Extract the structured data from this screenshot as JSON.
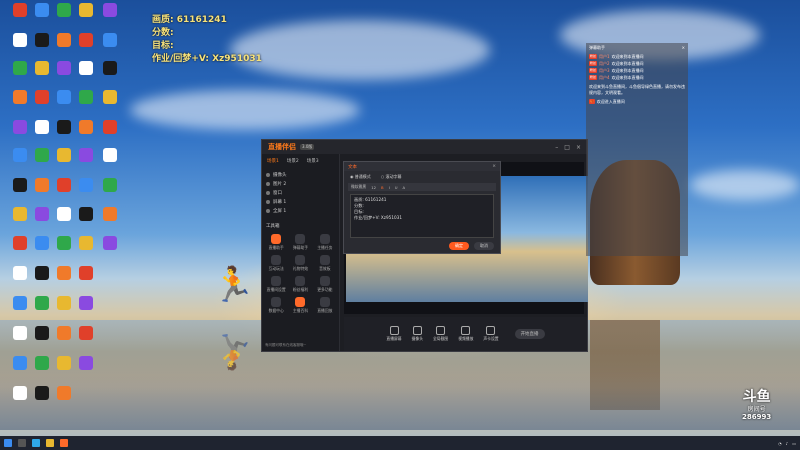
{
  "overlay": {
    "line1": "画质: 61161241",
    "line2": "分数:",
    "line3": "目标:",
    "line4": "作业/回梦+V: Xz951031"
  },
  "app": {
    "logo": "直播伴侣",
    "badge": "3.0版",
    "tabs": [
      "场景1",
      "场景2",
      "场景3"
    ],
    "sources": [
      "摄像头",
      "图片 2",
      "窗口",
      "屏幕 1",
      "全屏 1"
    ],
    "tools_heading": "工具箱",
    "tools": [
      "直播助手",
      "弹幕助手",
      "主播任务",
      "互动玩法",
      "礼物特效",
      "音效板",
      "直播间设置",
      "粉丝福利",
      "更多功能",
      "数据中心",
      "主播百科",
      "直播回放"
    ],
    "footnote": "有问题可联系在线客服哦~",
    "bottom_bar": [
      "直播屏幕",
      "摄像头",
      "全局截图",
      "视频播放",
      "声卡设置"
    ],
    "live_button": "开始直播"
  },
  "dialog": {
    "title": "文本",
    "radio1": "普通模式",
    "radio2": "滚动字幕",
    "font_select": "微软雅黑",
    "size": "12",
    "text_lines": [
      "画质: 61161241",
      "分数:",
      "目标:",
      "作业/回梦+V: Xz951031"
    ],
    "ok": "确定",
    "cancel": "取消"
  },
  "chat": {
    "title": "弹幕助手",
    "messages": [
      {
        "badge": "粉丝",
        "user": "用户1",
        "text": "欢迎来到本直播间"
      },
      {
        "badge": "粉丝",
        "user": "用户2",
        "text": "欢迎来到本直播间"
      },
      {
        "badge": "粉丝",
        "user": "用户3",
        "text": "欢迎来到本直播间"
      },
      {
        "badge": "粉丝",
        "user": "用户4",
        "text": "欢迎来到本直播间"
      }
    ],
    "notice": "欢迎来到斗鱼直播间，斗鱼倡导绿色直播，请勿发布违规内容，文明观看。",
    "gift_line": "欢迎进入直播间"
  },
  "douyu": {
    "brand": "斗鱼",
    "room_label": "房间号",
    "room_id": "286993"
  },
  "colors": {
    "accent": "#ff5a1f",
    "overlay_text": "#f7e27a",
    "app_bg": "#1d1e23"
  }
}
